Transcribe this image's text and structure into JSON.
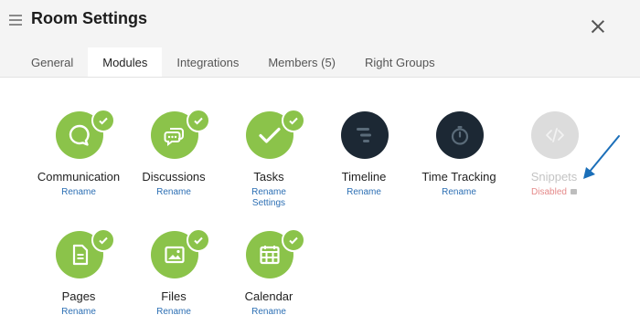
{
  "header": {
    "title": "Room Settings"
  },
  "tabs": [
    {
      "label": "General"
    },
    {
      "label": "Modules"
    },
    {
      "label": "Integrations"
    },
    {
      "label": "Members (5)"
    },
    {
      "label": "Right Groups"
    }
  ],
  "modules": {
    "communication": {
      "name": "Communication",
      "rename": "Rename"
    },
    "discussions": {
      "name": "Discussions",
      "rename": "Rename"
    },
    "tasks": {
      "name": "Tasks",
      "rename": "Rename",
      "settings": "Settings"
    },
    "timeline": {
      "name": "Timeline",
      "rename": "Rename"
    },
    "time_tracking": {
      "name": "Time Tracking",
      "rename": "Rename"
    },
    "snippets": {
      "name": "Snippets",
      "status": "Disabled"
    },
    "pages": {
      "name": "Pages",
      "rename": "Rename"
    },
    "files": {
      "name": "Files",
      "rename": "Rename"
    },
    "calendar": {
      "name": "Calendar",
      "rename": "Rename"
    }
  },
  "colors": {
    "active_green": "#8bc34a",
    "inactive_dark": "#1c2834",
    "disabled_grey": "#dcdcdc",
    "link_blue": "#2c6fb4",
    "disabled_red": "#e58a8a",
    "arrow_blue": "#1b6fb9"
  },
  "icons": {
    "menu": "hamburger-icon",
    "close": "close-icon",
    "check": "checkmark-icon"
  }
}
